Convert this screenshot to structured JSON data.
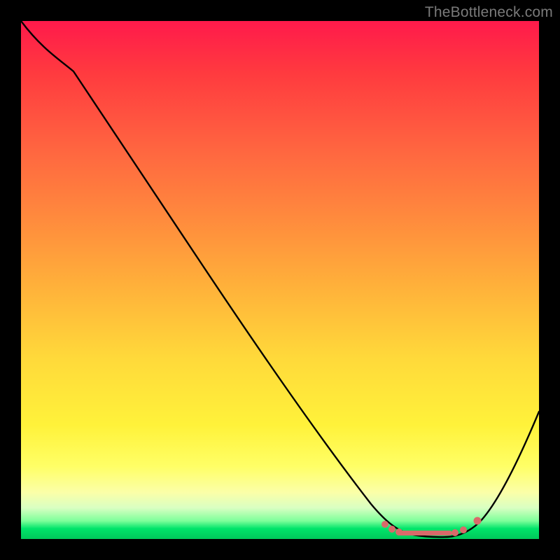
{
  "watermark": "TheBottleneck.com",
  "colors": {
    "page_bg": "#000000",
    "dot": "#d96a6a",
    "curve": "#000000"
  },
  "chart_data": {
    "type": "line",
    "title": "",
    "xlabel": "",
    "ylabel": "",
    "xlim": [
      0,
      100
    ],
    "ylim": [
      0,
      100
    ],
    "grid": false,
    "legend": false,
    "note": "Bottleneck-style curve; y is percentage (higher = worse). Values are read off the plotted shape.",
    "x": [
      0,
      2,
      5,
      8,
      12,
      18,
      25,
      35,
      45,
      55,
      62,
      68,
      72,
      75,
      78,
      80,
      82,
      85,
      88,
      92,
      96,
      100
    ],
    "y": [
      100,
      99,
      97,
      94,
      89,
      80,
      69,
      54,
      39,
      24,
      14,
      7,
      3,
      1,
      0,
      0,
      0,
      1,
      3,
      9,
      17,
      26
    ],
    "optimal_band_x": [
      72,
      86
    ],
    "markers": {
      "x": [
        70,
        72,
        73,
        74,
        75,
        76,
        77,
        78,
        79,
        80,
        81,
        82,
        83,
        84,
        85,
        86,
        88
      ],
      "y": [
        3,
        2,
        1,
        1,
        0.6,
        0.4,
        0.3,
        0.2,
        0.2,
        0.2,
        0.2,
        0.2,
        0.3,
        0.5,
        0.8,
        1,
        3
      ]
    }
  }
}
